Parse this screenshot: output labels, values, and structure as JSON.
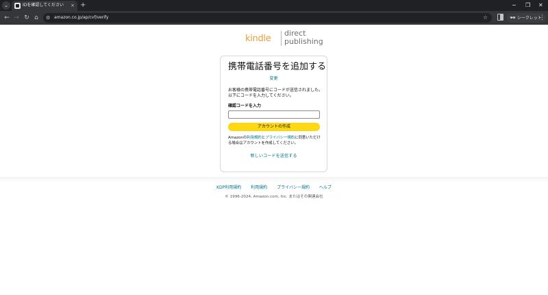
{
  "browser": {
    "tab_title": "IDを確認してください",
    "tab_close": "×",
    "new_tab": "+",
    "url": "amazon.co.jp/ap/cvf/verify",
    "incognito_label": "シークレット",
    "icons": [
      "tab-search-icon",
      "favicon-icon",
      "close-icon",
      "back-icon",
      "forward-icon",
      "reload-icon",
      "home-icon",
      "site-info-icon",
      "star-icon",
      "side-panel-icon",
      "incognito-icon",
      "menu-icon",
      "minimize-icon",
      "maximize-icon",
      "window-close-icon"
    ]
  },
  "logo": {
    "kindle": "kindle",
    "direct": "direct",
    "publishing": "publishing",
    "kindle_color": "#e3a03a"
  },
  "card": {
    "title": "携帯電話番号を追加する",
    "change_link": "変更",
    "description": "お客様の携帯電話番号にコードが送信されました。以下にコードを入力してください。",
    "field_label": "確認コードを入力",
    "input_value": "",
    "submit_label": "アカウントの作成",
    "terms_prefix": "Amazonの",
    "terms_link1": "利用規約",
    "terms_mid": "と",
    "terms_link2": "プライバシー規約",
    "terms_suffix": "に同意いただける場合はアカウントを作成してください。",
    "resend_link": "新しいコードを送信する",
    "button_color": "#ffd814",
    "link_color": "#007185"
  },
  "footer": {
    "links": [
      "KDP利用規約",
      "利用規約",
      "プライバシー規約",
      "ヘルプ"
    ],
    "copyright": "© 1996-2024, Amazon.com, Inc. またはその関連会社"
  }
}
